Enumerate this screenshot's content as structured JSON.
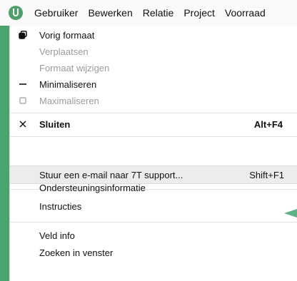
{
  "menubar": {
    "items": [
      "Gebruiker",
      "Bewerken",
      "Relatie",
      "Project",
      "Voorraad"
    ]
  },
  "menu": {
    "items": [
      {
        "label": "Vorig formaat",
        "icon": "restore-window-icon",
        "enabled": true
      },
      {
        "label": "Verplaatsen",
        "icon": "",
        "enabled": false
      },
      {
        "label": "Formaat wijzigen",
        "icon": "",
        "enabled": false
      },
      {
        "label": "Minimaliseren",
        "icon": "minimize-icon",
        "enabled": true
      },
      {
        "label": "Maximaliseren",
        "icon": "maximize-icon",
        "enabled": false
      },
      {
        "label": "Sluiten",
        "icon": "close-icon",
        "shortcut": "Alt+F4",
        "enabled": true,
        "bold": true
      },
      {
        "label": "Stuur een e-mail naar 7T support...",
        "shortcut": "Shift+F1",
        "enabled": true,
        "highlighted": true
      },
      {
        "label": "Ondersteuningsinformatie",
        "enabled": true
      },
      {
        "label": "Instructies",
        "enabled": true
      },
      {
        "label": "Veld info",
        "enabled": true
      },
      {
        "label": "Zoeken in venster",
        "enabled": true
      }
    ]
  },
  "colors": {
    "background": "#4aa56d",
    "accent": "#4fa06b",
    "disabled_text": "#9b9b9b"
  }
}
